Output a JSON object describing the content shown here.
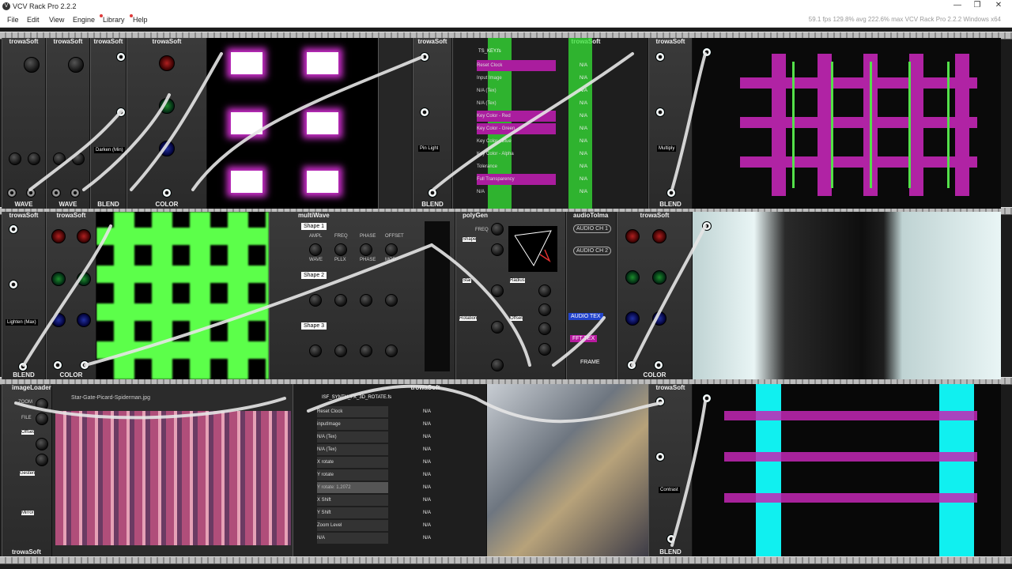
{
  "window": {
    "title": "VCV Rack Pro 2.2.2",
    "controls": [
      "—",
      "❐",
      "✕"
    ]
  },
  "menubar": {
    "items": [
      "File",
      "Edit",
      "View",
      "Engine",
      "Library",
      "Help"
    ],
    "status": "59.1 fps  129.8% avg  222.6% max     VCV Rack Pro 2.2.2 Windows x64"
  },
  "row1": {
    "wave1": {
      "title": "trowaSoft",
      "footer": "WAVE"
    },
    "wave2": {
      "title": "trowaSoft",
      "footer": "WAVE"
    },
    "blend1": {
      "title": "trowaSoft",
      "footer": "BLEND",
      "mode": "Darken (Min)"
    },
    "color1": {
      "title": "trowaSoft",
      "footer": "COLOR"
    },
    "blend2": {
      "title": "trowaSoft",
      "footer": "BLEND",
      "mode": "Pin Light"
    },
    "key": {
      "title": "trowaSoft",
      "file": "TS_KEY.fs",
      "rows": [
        "Reset Clock",
        "Input Image",
        "N/A (Tex)",
        "N/A (Tex)",
        "Key Color - Red",
        "Key Color - Green",
        "Key Color - Blue",
        "Key Color - Alpha",
        "Tolerance",
        "Full Transparency",
        "N/A"
      ],
      "values": [
        "N/A",
        "N/A",
        "N/A",
        "N/A",
        "N/A",
        "N/A",
        "N/A",
        "N/A",
        "N/A",
        "N/A",
        "N/A"
      ]
    },
    "blend3": {
      "title": "trowaSoft",
      "footer": "BLEND",
      "mode": "Multiply"
    }
  },
  "row2": {
    "blend4": {
      "title": "trowaSoft",
      "footer": "BLEND",
      "mode": "Lighten (Max)"
    },
    "color2": {
      "title": "trowaSoft",
      "footer": "COLOR"
    },
    "multiwave": {
      "title": "multiWave",
      "shapes": [
        "Shape 1",
        "Shape 2",
        "Shape 3"
      ],
      "param_labels": [
        "AMPL",
        "FREQ",
        "PHASE",
        "OFFSET",
        "WAVE",
        "PLLX",
        "PHASE",
        "MOD"
      ]
    },
    "polygen": {
      "title": "polyGen",
      "labels": [
        "FREQ",
        "Shape",
        "Star",
        "Radius",
        "Rotation",
        "Offset",
        "R",
        "X",
        "Y"
      ]
    },
    "audio": {
      "title": "audioToIma",
      "buttons": [
        "AUDIO CH 1",
        "AUDIO CH 2",
        "AUDIO TEX",
        "FFT TEX",
        "FRAME"
      ]
    },
    "color3": {
      "title": "trowaSoft",
      "footer": "COLOR"
    }
  },
  "row3": {
    "imageloader": {
      "title": "imageLoader",
      "file": "Star-Gate-Picard-Spiderman.jpg",
      "labels": [
        "ZOOM",
        "FILE",
        "Offset",
        "Gesten",
        "Mirror"
      ],
      "footer": "trowaSoft"
    },
    "isf": {
      "title": "trowaSoft",
      "file": "ISF_SYNTH_FX_3D_ROTATE.fs",
      "rows": [
        "Reset Clock",
        "inputImage",
        "N/A (Tex)",
        "N/A (Tex)",
        "X rotate",
        "Y rotate",
        "",
        "X Shift",
        "Y Shift",
        "Zoom Level",
        "N/A"
      ],
      "values": [
        "N/A",
        "N/A",
        "N/A",
        "N/A",
        "N/A",
        "N/A",
        "N/A",
        "N/A",
        "N/A",
        "N/A",
        "N/A"
      ],
      "tooltip": "Y rotate: 1.2072"
    },
    "blend5": {
      "title": "trowaSoft",
      "footer": "BLEND",
      "mode": "Contrast"
    }
  },
  "colors": {
    "accent_purple": "#c030c0",
    "accent_green": "#5cff4a",
    "accent_cyan": "#10f0f0"
  }
}
